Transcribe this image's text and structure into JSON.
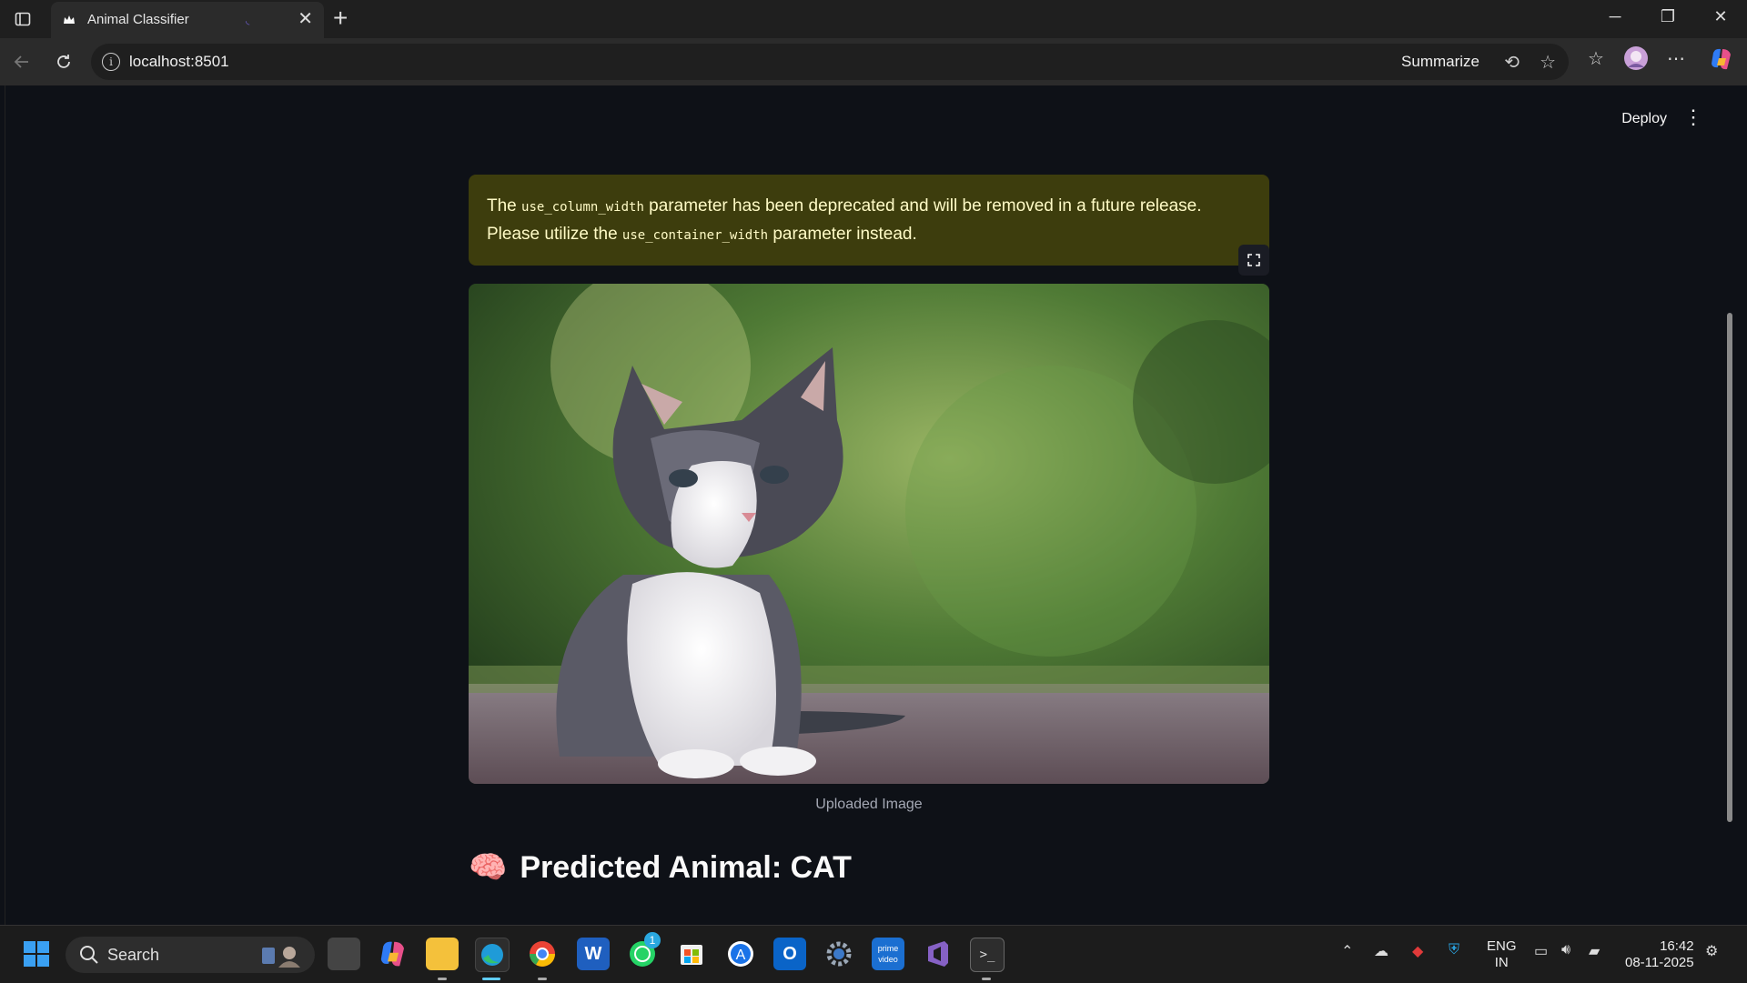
{
  "browser": {
    "tab_title": "Animal Classifier",
    "url": "localhost:8501",
    "summarize_label": "Summarize"
  },
  "app": {
    "deploy_label": "Deploy",
    "warning": {
      "part1": "The ",
      "code1": "use_column_width",
      "part2": " parameter has been deprecated and will be removed in a future release. Please utilize the ",
      "code2": "use_container_width",
      "part3": " parameter instead."
    },
    "image_caption": "Uploaded Image",
    "prediction_emoji": "🧠",
    "prediction_text": "Predicted Animal: CAT"
  },
  "taskbar": {
    "search_placeholder": "Search",
    "whatsapp_badge": "1",
    "lang_top": "ENG",
    "lang_bottom": "IN",
    "time": "16:42",
    "date": "08-11-2025"
  }
}
